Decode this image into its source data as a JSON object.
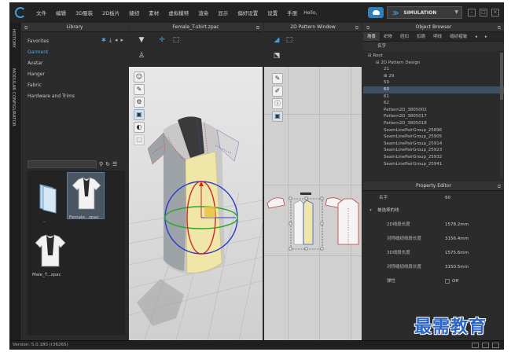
{
  "menubar": {
    "items": [
      "文件",
      "编辑",
      "3D服装",
      "2D板片",
      "缝纫",
      "素材",
      "虚拟模特",
      "渲染",
      "显示",
      "偏好设置",
      "设置",
      "手册"
    ],
    "hello": "Hello,",
    "simulation_label": "SIMULATION",
    "accent": "#3fa0d8"
  },
  "rail": {
    "history": "HISTORY",
    "modular": "MODULAR CONFIGURATOR"
  },
  "library": {
    "title": "Library",
    "items": [
      "Favorites",
      "Garment",
      "Avatar",
      "Hanger",
      "Fabric",
      "Hardware and Trims"
    ],
    "selected": "Garment",
    "thumbs": [
      {
        "label": "..",
        "icon": "folder-icon"
      },
      {
        "label": "Female...zpac",
        "icon": "tshirt-icon"
      },
      {
        "label": "Male_T...zpac",
        "icon": "tshirt-icon"
      }
    ]
  },
  "window3d": {
    "title": "Female_T-shirt.zpac"
  },
  "window2d": {
    "title": "2D Pattern Window"
  },
  "object_browser": {
    "title": "Object Browser",
    "tabs": [
      "场景",
      "织物",
      "纽扣",
      "扣眼",
      "明线",
      "缝纫褶皱"
    ],
    "active_tab": "场景",
    "column": "名字",
    "tree": [
      {
        "label": "Root",
        "indent": 0,
        "prefix": "⊟"
      },
      {
        "label": "2D Pattern Design",
        "indent": 1,
        "prefix": "⊟"
      },
      {
        "label": "21",
        "indent": 2,
        "prefix": ""
      },
      {
        "label": "29",
        "indent": 2,
        "prefix": "⊞"
      },
      {
        "label": "59",
        "indent": 2,
        "prefix": ""
      },
      {
        "label": "60",
        "indent": 2,
        "prefix": "",
        "selected": true
      },
      {
        "label": "61",
        "indent": 2,
        "prefix": ""
      },
      {
        "label": "62",
        "indent": 2,
        "prefix": ""
      },
      {
        "label": "Pattern2D_3805002",
        "indent": 2,
        "prefix": ""
      },
      {
        "label": "Pattern2D_3805017",
        "indent": 2,
        "prefix": ""
      },
      {
        "label": "Pattern2D_3805018",
        "indent": 2,
        "prefix": ""
      },
      {
        "label": "SeamLinePairGroup_25896",
        "indent": 2,
        "prefix": ""
      },
      {
        "label": "SeamLinePairGroup_25905",
        "indent": 2,
        "prefix": ""
      },
      {
        "label": "SeamLinePairGroup_25914",
        "indent": 2,
        "prefix": ""
      },
      {
        "label": "SeamLinePairGroup_25923",
        "indent": 2,
        "prefix": ""
      },
      {
        "label": "SeamLinePairGroup_25932",
        "indent": 2,
        "prefix": ""
      },
      {
        "label": "SeamLinePairGroup_25941",
        "indent": 2,
        "prefix": ""
      }
    ]
  },
  "property_editor": {
    "title": "Property Editor",
    "name_key": "名字",
    "name_value": "60",
    "section": "被选择的线",
    "rows": [
      {
        "key": "2D线段长度",
        "value": "1578.2mm"
      },
      {
        "key": "对称缝纫线段长度",
        "value": "3156.4mm"
      },
      {
        "key": "3D线段长度",
        "value": "1575.6mm"
      },
      {
        "key": "对称缝纫线段长度",
        "value": "3150.5mm"
      },
      {
        "key": "弹性",
        "value": "Off"
      }
    ]
  },
  "status": {
    "version": "Version: 5.0.180 (r36265)"
  },
  "watermark": "最需教育"
}
